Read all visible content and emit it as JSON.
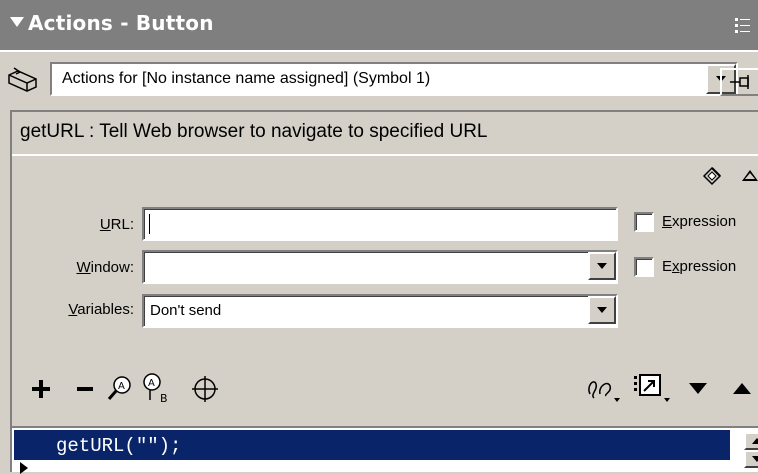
{
  "panel": {
    "title": "Actions - Button",
    "collapse_icon": "triangle-down-icon",
    "menu_icon": "panel-options-icon"
  },
  "actions_for": {
    "label": "Actions for [No instance name assigned]  (Symbol 1)",
    "icon": "button-symbol-icon",
    "pin_icon": "pin-icon"
  },
  "description": "getURL : Tell Web browser to navigate to specified URL",
  "form": {
    "url": {
      "label_u": "U",
      "label_rest": "RL:",
      "value": ""
    },
    "window": {
      "label_u": "W",
      "label_rest": "indow:",
      "value": ""
    },
    "variables": {
      "label_u": "V",
      "label_rest": "ariables:",
      "value": "Don't send"
    },
    "expression1": {
      "label_u": "E",
      "label_rest": "xpression",
      "checked": false
    },
    "expression2": {
      "label_pre": "E",
      "label_u": "x",
      "label_rest": "pression",
      "checked": false
    }
  },
  "toolbar": {
    "left": [
      "add-icon",
      "remove-icon",
      "find-icon",
      "replace-icon",
      "insert-target-path-icon"
    ],
    "right": [
      "debug-options-icon",
      "view-options-icon",
      "move-down-icon",
      "move-up-icon"
    ]
  },
  "code": {
    "line1": "getURL(\"\");"
  },
  "colors": {
    "title_bar": "#7f7f7f",
    "panel_bg": "#d4d0c8",
    "selection": "#0a246a"
  }
}
